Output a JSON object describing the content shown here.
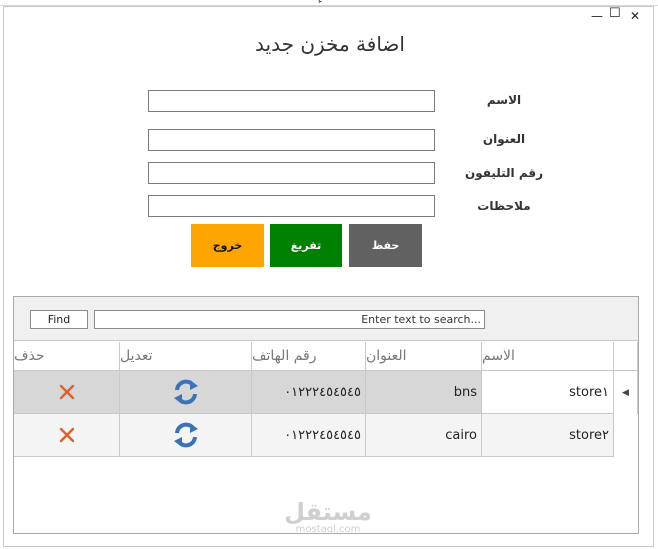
{
  "window": {
    "title_glyph": "ء",
    "minimize": "—",
    "maximize": "☐",
    "close": "✕"
  },
  "form": {
    "title": "اضافة مخزن جديد",
    "fields": [
      {
        "label": "الاسم",
        "value": ""
      },
      {
        "label": "العنوان",
        "value": ""
      },
      {
        "label": "رقم التليفون",
        "value": ""
      },
      {
        "label": "ملاحظات",
        "value": ""
      }
    ],
    "buttons": {
      "save": "حفظ",
      "clear": "تفريغ",
      "exit": "خروج"
    }
  },
  "colors": {
    "save": "#616161",
    "clear": "#008000",
    "exit": "#ffa500",
    "delete_icon": "#d9622b",
    "refresh_icon": "#3a73b8"
  },
  "grid": {
    "find_label": "Find",
    "search_placeholder": "Enter text to search...",
    "columns": [
      "الاسم",
      "العنوان",
      "رقم الهاتف",
      "تعديل",
      "حذف"
    ],
    "rows": [
      {
        "name": "store١",
        "address": "bns",
        "phone": "٠١٢٢٢٤٥٤٥٤٥",
        "edit_icon": "refresh-icon",
        "delete_icon": "close-icon"
      },
      {
        "name": "store٢",
        "address": "cairo",
        "phone": "٠١٢٢٢٤٥٤٥٤٥",
        "edit_icon": "refresh-icon",
        "delete_icon": "close-icon"
      }
    ]
  },
  "watermark": {
    "text_ar": "مستقل",
    "text_en": "mostaql.com"
  }
}
